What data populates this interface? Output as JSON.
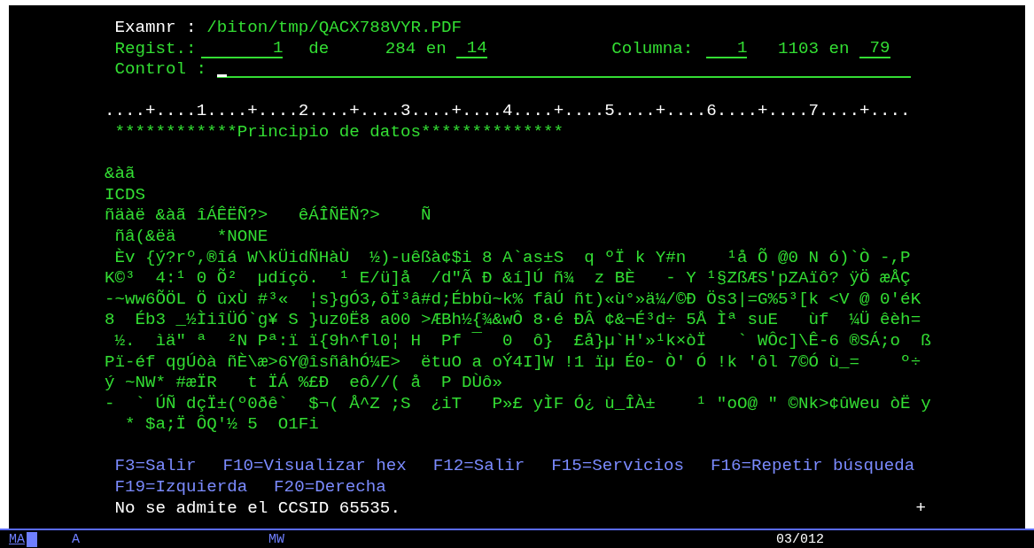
{
  "header": {
    "file_label": "Examnr :",
    "file_path": "/biton/tmp/QACX788VYR.PDF",
    "record_label": "Regist.:",
    "record_field": "1",
    "of_label": "de",
    "record_total": "284",
    "record_in_label": "en",
    "record_width_field": "14",
    "column_label": "Columna:",
    "column_field": "1",
    "column_total": "1103",
    "column_in_label": "en",
    "column_width_field": "79",
    "control_label": "Control :"
  },
  "ruler": "....+....1....+....2....+....3....+....4....+....5....+....6....+....7....+....",
  "data_start": "************Principio de datos**************",
  "data_lines": [
    "&àã",
    "ICDS",
    "ñäàë &àã îÁÊËÑ?>   êÁÎÑËÑ?>    Ñ",
    " ñâ(&ëä    *NONE",
    " Èv {ý?rº,®îá W\\kÜidÑHàÙ  ½)-uêßà¢$i 8 A`as±S  q ºÏ k Y#n    ¹å Õ @0 N ó)`Ò -,P",
    "K©³  4:¹ 0 Õ²  µdíçö.  ¹ E/ü]å  /d\"Ã Ð &í]Ú ñ¾  z BÈ   - Y ¹§ZßÆS'pZAïô? ÿÖ æÅÇ",
    "-~ww6ÕÖL Ö ûxÙ #³«  ¦s}gÓ3,ôÏ³â#d;Ébbû~k% fâÚ ñt)«ù°»ä¼/©Ð Ös3|=G%5³[k <V @ 0'éK",
    "8  Éb3 _½ÌiîÜÓ`g¥ S }uz0Ë8 a00 >ÆBh½{¾&wÔ 8·é ÐÂ ¢&¬É³d÷ 5Å Ìª suE   ùf  ¼Ü êèh=",
    " ½.  ìä\" ª  ²N Pª:ï ï{9h^fl0¦ H  Pf ¯  0  ô}  £å}µ`H'»¹k×òÏ   ` WÔc]\\Ê-6 ®SÁ;o  ß",
    "Pï-éf qgÚòà ñÈ\\æ>6Y@îsñâhÓ¼E>  ëtuO a oÝ4I]W !1 ïµ É0- Ò' Ó !k 'ôl 7©Ó ù_=    º÷",
    "ý ~NW* #æÏR   t ÏÁ %£Ð  eô//( å  P DÙô»",
    "-  ` ÚÑ dçÏ±(º0ðê`  $¬( Å^Z ;S  ¿iT   P»£ yÌF Ó¿ ù_ÎÀ±    ¹ \"oO@ \" ©Nk>¢ûWeu òË y",
    "  * $a;Ï ÔQ'½ 5  O1Fi"
  ],
  "function_keys": [
    [
      "F3=Salir",
      "F10=Visualizar hex",
      "F12=Salir",
      "F15=Servicios",
      "F16=Repetir búsqueda"
    ],
    [
      "F19=Izquierda",
      "F20=Derecha"
    ]
  ],
  "message": "No se admite el CCSID 65535.",
  "more_indicator": "+",
  "status_bar": {
    "mode": "MA",
    "field_2": "A",
    "field_3": "MW",
    "cursor_position": "03/012"
  }
}
